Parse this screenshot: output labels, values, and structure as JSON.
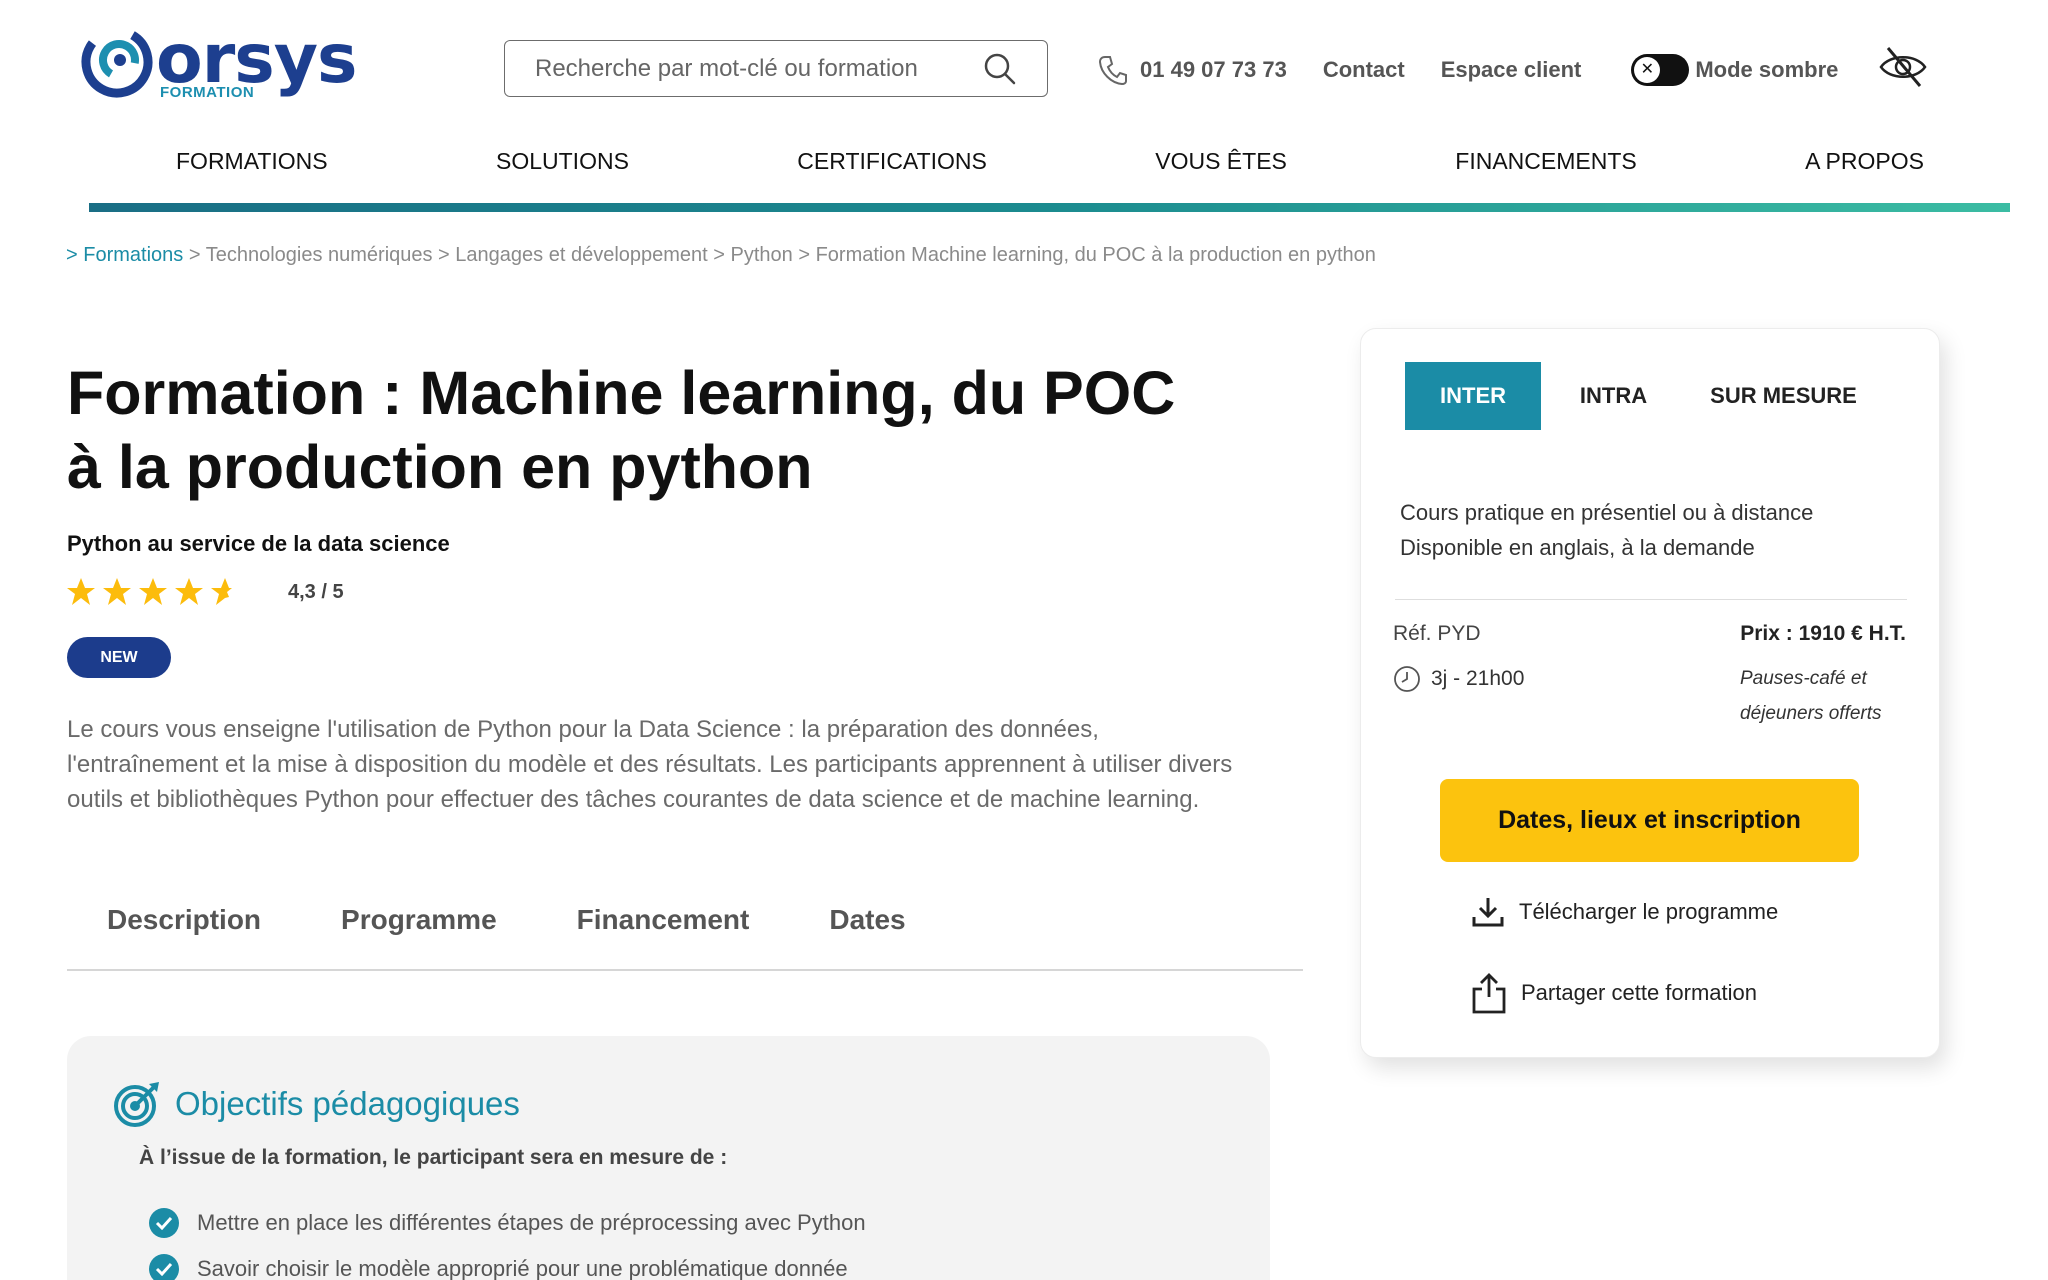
{
  "brand": {
    "logo_text": "orsys",
    "logo_sub": "FORMATION",
    "colors": {
      "navy": "#1d3f8f",
      "teal": "#1b8ca6",
      "yellow": "#fcc30e"
    }
  },
  "header": {
    "search_placeholder": "Recherche par mot-clé ou formation",
    "phone": "01 49 07 73 73",
    "contact": "Contact",
    "espace_client": "Espace client",
    "dark_mode": "Mode sombre",
    "dark_mode_on": false
  },
  "nav": {
    "items": [
      "FORMATIONS",
      "SOLUTIONS",
      "CERTIFICATIONS",
      "VOUS ÊTES",
      "FINANCEMENTS",
      "A PROPOS"
    ]
  },
  "breadcrumb": {
    "first": "> Formations",
    "rest": " > Technologies numériques > Langages et développement > Python > Formation Machine learning, du POC à la production en python"
  },
  "course": {
    "title": "Formation : Machine learning, du POC à la production en python",
    "subtitle": "Python au service de la data science",
    "rating": 4.3,
    "rating_label": "4,3 / 5",
    "badge": "NEW",
    "description": "Le cours vous enseigne l'utilisation de Python pour la Data Science : la préparation des données, l'entraînement et la mise à disposition du modèle et des résultats. Les participants apprennent à utiliser divers outils et bibliothèques Python pour effectuer des tâches courantes de data science et de machine learning."
  },
  "tabs": [
    "Description",
    "Programme",
    "Financement",
    "Dates"
  ],
  "objectives": {
    "title": "Objectifs pédagogiques",
    "intro": "À l’issue de la formation, le participant sera en mesure de :",
    "items": [
      "Mettre en place les différentes étapes de préprocessing avec Python",
      "Savoir choisir le modèle approprié pour une problématique donnée"
    ]
  },
  "panel": {
    "tabs": [
      "INTER",
      "INTRA",
      "SUR MESURE"
    ],
    "active_tab": "INTER",
    "info_line1": "Cours pratique en présentiel ou à distance",
    "info_line2": "Disponible en anglais, à la demande",
    "ref": "Réf. PYD",
    "duration": "3j - 21h00",
    "price": "Prix : 1910 € H.T.",
    "price_note": "Pauses-café et déjeuners offerts",
    "cta": "Dates, lieux et inscription",
    "download": "Télécharger le programme",
    "share": "Partager cette formation"
  }
}
